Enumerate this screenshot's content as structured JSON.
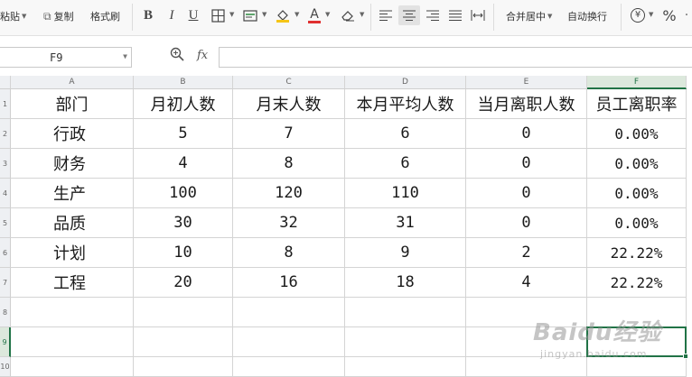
{
  "ribbon": {
    "paste_label": "粘贴",
    "copy_label": "复制",
    "format_painter_label": "格式刷",
    "bold_icon": "B",
    "italic_icon": "I",
    "underline_icon": "U",
    "merge_center_label": "合并居中",
    "wrap_text_label": "自动换行",
    "currency_icon": "¥",
    "percent_icon": "%"
  },
  "formula_bar": {
    "name_box": "F9",
    "fx_label": "fx",
    "formula": ""
  },
  "columns": [
    "A",
    "B",
    "C",
    "D",
    "E",
    "F"
  ],
  "selected_column": "F",
  "rows": [
    "1",
    "2",
    "3",
    "4",
    "5",
    "6",
    "7",
    "8",
    "9",
    "10"
  ],
  "selected_row": "9",
  "table": {
    "headers": [
      "部门",
      "月初人数",
      "月末人数",
      "本月平均人数",
      "当月离职人数",
      "员工离职率"
    ],
    "data": [
      [
        "行政",
        "5",
        "7",
        "6",
        "0",
        "0.00%"
      ],
      [
        "财务",
        "4",
        "8",
        "6",
        "0",
        "0.00%"
      ],
      [
        "生产",
        "100",
        "120",
        "110",
        "0",
        "0.00%"
      ],
      [
        "品质",
        "30",
        "32",
        "31",
        "0",
        "0.00%"
      ],
      [
        "计划",
        "10",
        "8",
        "9",
        "2",
        "22.22%"
      ],
      [
        "工程",
        "20",
        "16",
        "18",
        "4",
        "22.22%"
      ]
    ]
  },
  "watermark": {
    "main": "Baidu经验",
    "sub": "jingyan.baidu.com"
  },
  "colors": {
    "selection": "#217346",
    "grid_line": "#d4d4d4",
    "header_bg": "#eef0f3"
  }
}
